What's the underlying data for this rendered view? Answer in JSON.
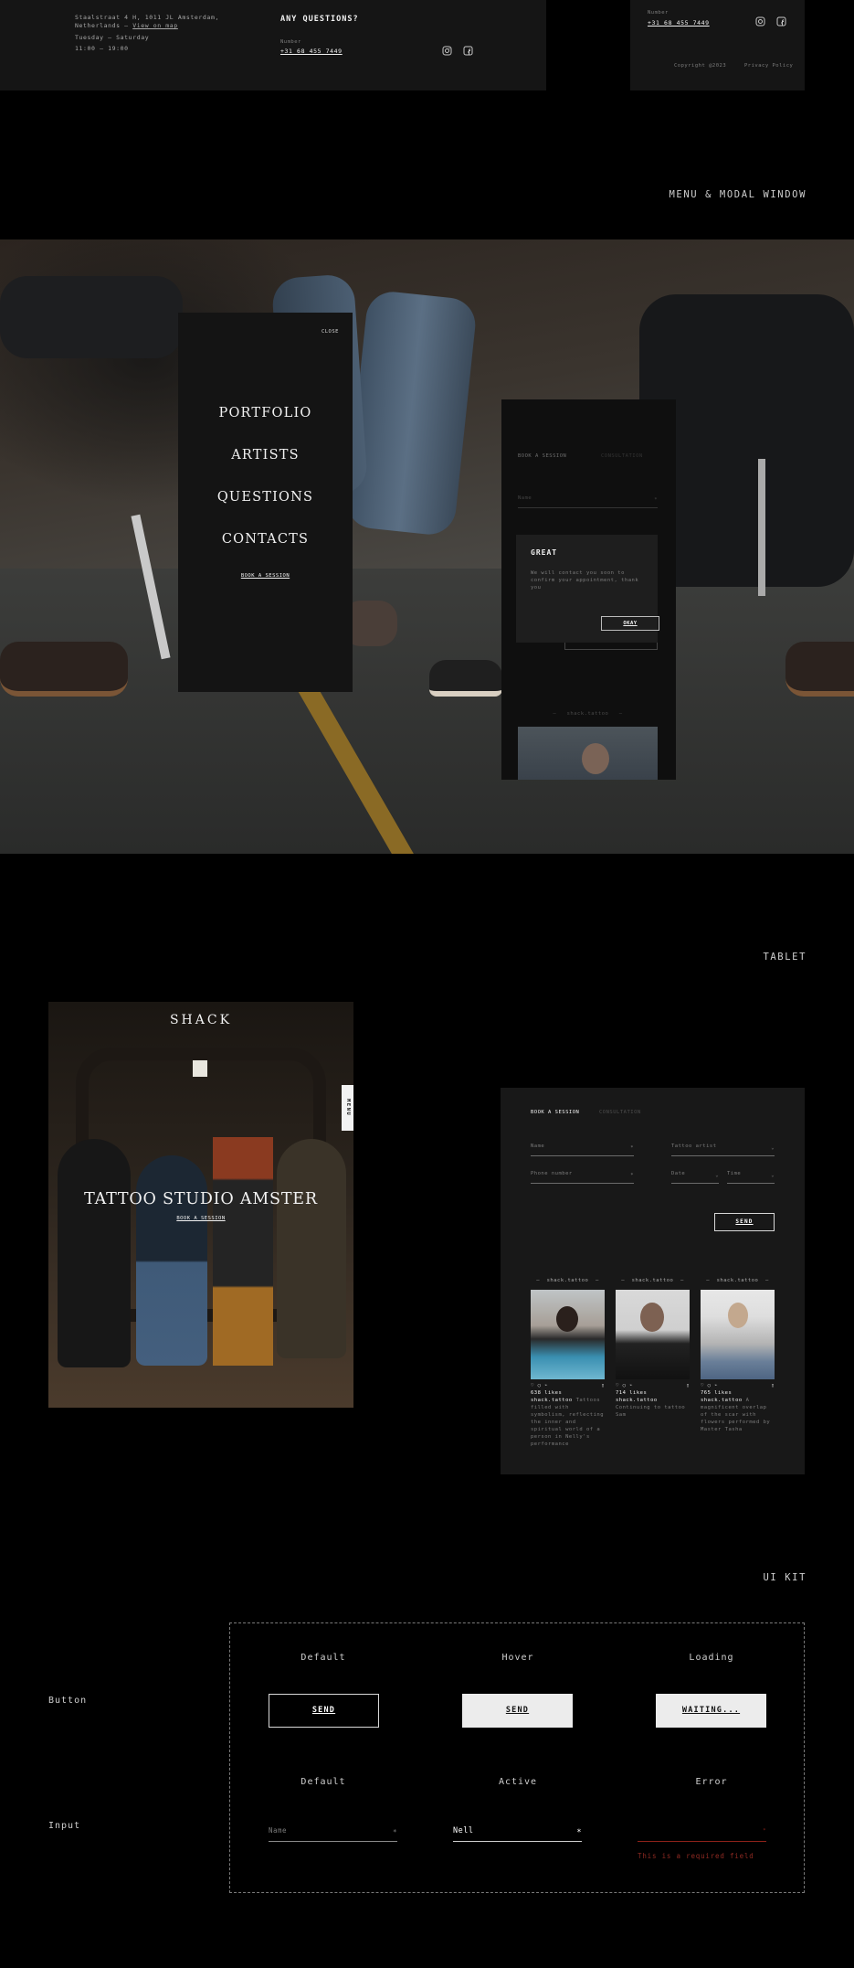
{
  "footer_left": {
    "address": "Staalstraat 4 H, 1011 JL Amsterdam,",
    "address2": "Netherlands — ",
    "map_link": "View on map",
    "days": "Tuesday — Saturday",
    "hours": "11:00 — 19:00",
    "questions": "ANY QUESTIONS?",
    "number_label": "Number",
    "phone": "+31 68 455 7449"
  },
  "footer_right": {
    "number_label": "Number",
    "phone": "+31 68 455 7449",
    "copyright": "Copyright @2023",
    "privacy": "Privacy Policy"
  },
  "sections": {
    "menu_modal": "MENU & MODAL WINDOW",
    "tablet": "TABLET",
    "ui_kit": "UI KIT"
  },
  "menu": {
    "close": "CLOSE",
    "items": [
      "PORTFOLIO",
      "ARTISTS",
      "QUESTIONS",
      "CONTACTS"
    ],
    "cta": "BOOK A SESSION"
  },
  "modal_phone": {
    "tab_book": "BOOK A SESSION",
    "tab_consult": "CONSULTATION",
    "name_placeholder": "Name",
    "popup_title": "GREAT",
    "popup_text": "We will contact you soon to confirm your appointment, thank you",
    "popup_btn": "OKAY",
    "insta_handle": "shack.tattoo"
  },
  "tablet_hero": {
    "logo": "SHACK",
    "menu_tab": "MENU",
    "title": "TATTOO STUDIO AMSTER",
    "cta": "BOOK A SESSION"
  },
  "tablet_form": {
    "tab_book": "BOOK A SESSION",
    "tab_consult": "CONSULTATION",
    "name": "Name",
    "artist": "Tattoo artist",
    "phone": "Phone number",
    "date": "Date",
    "time": "Time",
    "send": "SEND",
    "posts": [
      {
        "handle": "shack.tattoo",
        "likes": "638 likes",
        "user": "shack.tattoo",
        "caption": "Tattoos filled with symbolism, reflecting the inner and spiritual world of a person in Nelly's performance"
      },
      {
        "handle": "shack.tattoo",
        "likes": "714 likes",
        "user": "shack.tattoo",
        "caption": "Continuing to tattoo Sam"
      },
      {
        "handle": "shack.tattoo",
        "likes": "765 likes",
        "user": "shack.tattoo",
        "caption": "A magnificent overlap of the scar with flowers performed by Master Tasha"
      }
    ]
  },
  "ui_kit": {
    "button_label": "Button",
    "input_label": "Input",
    "btn_states": [
      "Default",
      "Hover",
      "Loading"
    ],
    "btn_texts": [
      "SEND",
      "SEND",
      "WAITING..."
    ],
    "input_states": [
      "Default",
      "Active",
      "Error"
    ],
    "input_default": "Name",
    "input_active": "Nell",
    "error_text": "This is a required field",
    "error_color": "#a3261f"
  }
}
